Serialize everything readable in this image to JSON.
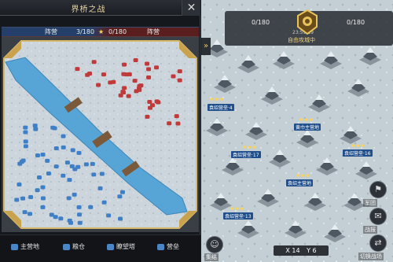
{
  "left_panel": {
    "title": "界桥之战",
    "close_label": "✕",
    "score_left": "3/180",
    "score_right": "0/180",
    "team_left": "阵营",
    "team_right": "阵营"
  },
  "legend": {
    "items": [
      {
        "label": "主营地",
        "icon": "main-camp-icon",
        "color": "#4a86c5"
      },
      {
        "label": "粮仓",
        "icon": "granary-icon",
        "color": "#4a86c5"
      },
      {
        "label": "瞭望塔",
        "icon": "watchtower-icon",
        "color": "#4a86c5"
      },
      {
        "label": "营垒",
        "icon": "fort-icon",
        "color": "#4a86c5"
      }
    ]
  },
  "right_panel": {
    "hud_left": "0/180",
    "hud_right": "0/180",
    "hud_center": "自由攻城中",
    "hud_sub": "23:59:19",
    "camps": [
      {
        "label": "袁绍营垒·17"
      },
      {
        "label": "黄巾主营地"
      },
      {
        "label": "袁绍主营地"
      },
      {
        "label": "袁绍营垒·13"
      },
      {
        "label": "袁绍营垒·4"
      },
      {
        "label": "袁绍营垒·16"
      }
    ],
    "side_buttons": [
      {
        "label": "军团"
      },
      {
        "label": "战报"
      },
      {
        "label": "切换战场"
      }
    ],
    "coord_x": "X 14",
    "coord_y": "Y 6",
    "bottom_left_label": "集结",
    "nav_arrow": "»"
  },
  "colors": {
    "blue_team": "#3f7fc6",
    "red_team": "#c13a3a",
    "river": "#4b9fd6",
    "snow": "#d6dee4"
  }
}
